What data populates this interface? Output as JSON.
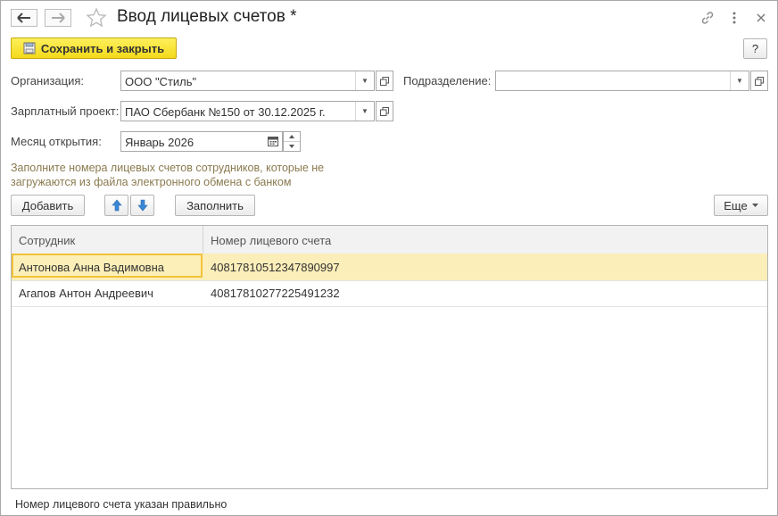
{
  "window": {
    "title": "Ввод лицевых счетов *"
  },
  "toolbar": {
    "save_close_label": "Сохранить и закрыть",
    "help_label": "?"
  },
  "form": {
    "organization": {
      "label": "Организация:",
      "value": "ООО \"Стиль\""
    },
    "subdivision": {
      "label": "Подразделение:",
      "value": ""
    },
    "salary_project": {
      "label": "Зарплатный проект:",
      "value": "ПАО Сбербанк №150 от 30.12.2025 г."
    },
    "opening_month": {
      "label": "Месяц открытия:",
      "value": "Январь 2026"
    }
  },
  "hint": "Заполните номера лицевых счетов сотрудников, которые не загружаются из файла электронного обмена с банком",
  "table_toolbar": {
    "add_label": "Добавить",
    "fill_label": "Заполнить",
    "more_label": "Еще"
  },
  "table": {
    "columns": [
      "Сотрудник",
      "Номер лицевого счета"
    ],
    "rows": [
      {
        "employee": "Антонова Анна Вадимовна",
        "account": "40817810512347890997"
      },
      {
        "employee": "Агапов Антон Андреевич",
        "account": "40817810277225491232"
      }
    ]
  },
  "status": "Номер лицевого счета указан правильно",
  "colors": {
    "primary_button": "#f3d91a",
    "selected_row": "#fbeeb9",
    "hint_text": "#8a7a4f",
    "arrow_blue": "#3a87d6"
  }
}
